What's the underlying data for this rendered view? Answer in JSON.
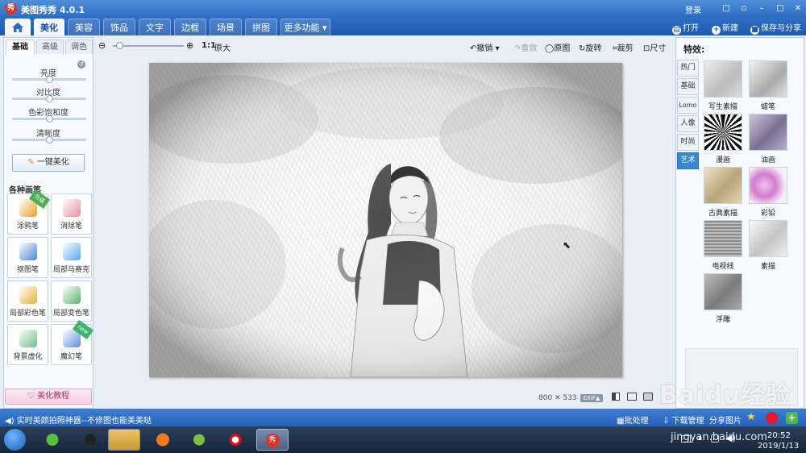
{
  "app": {
    "logo_char": "秀",
    "title": "美图秀秀 4.0.1",
    "login": "登录"
  },
  "window_controls": [
    "□",
    "▫",
    "–",
    "□",
    "✕"
  ],
  "nav": {
    "tabs": [
      "美化",
      "美容",
      "饰品",
      "文字",
      "边框",
      "场景",
      "拼图",
      "更多功能 ▾"
    ],
    "active": 0
  },
  "top_actions": {
    "open": "打开",
    "new": "新建",
    "save_share": "保存与分享"
  },
  "left_panel": {
    "subtabs": [
      "基础",
      "高级",
      "调色"
    ],
    "sliders": [
      {
        "label": "亮度",
        "value": 0.5
      },
      {
        "label": "对比度",
        "value": 0.5
      },
      {
        "label": "色彩饱和度",
        "value": 0.5
      },
      {
        "label": "清晰度",
        "value": 0.5
      }
    ],
    "beautify_button": "一键美化",
    "brushes_title": "各种画笔",
    "tools": [
      {
        "label": "涂鸦笔",
        "badge": "升级",
        "color": "#e6a12a"
      },
      {
        "label": "消除笔",
        "badge": "",
        "color": "#e58fa0"
      },
      {
        "label": "抠图笔",
        "badge": "",
        "color": "#4a86d6"
      },
      {
        "label": "局部马赛克",
        "badge": "",
        "color": "#5aa8e8"
      },
      {
        "label": "局部彩色笔",
        "badge": "",
        "color": "#e6b23a"
      },
      {
        "label": "局部变色笔",
        "badge": "",
        "color": "#5bb36a"
      },
      {
        "label": "背景虚化",
        "badge": "",
        "color": "#6fbf85"
      },
      {
        "label": "魔幻笔",
        "badge": "new",
        "color": "#5b8fe0"
      }
    ],
    "tutorial_button": "美化教程"
  },
  "toolbar": {
    "zoom_ratio": "1:1",
    "original_size": "原大",
    "undo": "撤销",
    "redo": "重做",
    "original": "原图",
    "rotate": "旋转",
    "crop": "裁剪",
    "size": "尺寸",
    "zoom_level": 0.05
  },
  "canvas": {
    "width": "800",
    "cross": "✕",
    "height": "533",
    "exif": "EXIF▲"
  },
  "right_panel": {
    "title": "特效:",
    "categories": [
      "热门",
      "基础",
      "Lomo",
      "人像",
      "时尚",
      "艺术"
    ],
    "active_category": 5,
    "effects": [
      "写生素描",
      "蜡笔",
      "漫画",
      "油画",
      "古典素描",
      "彩铅",
      "电视线",
      "素描",
      "浮雕"
    ]
  },
  "status": {
    "message": "实时美颜拍照神器--不修图也能美美哒",
    "batch": "批处理",
    "download": "下载管理",
    "share": "分享图片"
  },
  "taskbar": {
    "time": "20:52",
    "date": "2019/1/13"
  },
  "watermark": {
    "brand": "Baidu经验",
    "url": "jingyan.baidu.com"
  }
}
